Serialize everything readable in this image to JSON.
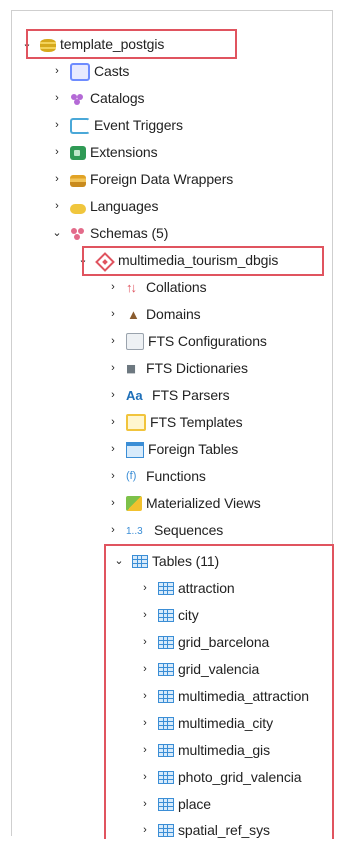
{
  "tree": {
    "database": {
      "label": "template_postgis"
    },
    "db_children": [
      {
        "label": "Casts",
        "icon": "casts-icon"
      },
      {
        "label": "Catalogs",
        "icon": "catalogs-icon"
      },
      {
        "label": "Event Triggers",
        "icon": "event-triggers-icon"
      },
      {
        "label": "Extensions",
        "icon": "extensions-icon"
      },
      {
        "label": "Foreign Data Wrappers",
        "icon": "foreign-data-wrappers-icon"
      },
      {
        "label": "Languages",
        "icon": "languages-icon"
      }
    ],
    "schemas": {
      "label": "Schemas (5)"
    },
    "schema": {
      "label": "multimedia_tourism_dbgis"
    },
    "schema_children": [
      {
        "label": "Collations",
        "icon": "collations-icon"
      },
      {
        "label": "Domains",
        "icon": "domains-icon"
      },
      {
        "label": "FTS Configurations",
        "icon": "fts-configurations-icon"
      },
      {
        "label": "FTS Dictionaries",
        "icon": "fts-dictionaries-icon"
      },
      {
        "label": "FTS Parsers",
        "icon": "fts-parsers-icon"
      },
      {
        "label": "FTS Templates",
        "icon": "fts-templates-icon"
      },
      {
        "label": "Foreign Tables",
        "icon": "foreign-tables-icon"
      },
      {
        "label": "Functions",
        "icon": "functions-icon"
      },
      {
        "label": "Materialized Views",
        "icon": "materialized-views-icon"
      },
      {
        "label": "Sequences",
        "icon": "sequences-icon"
      }
    ],
    "tables": {
      "label": "Tables (11)"
    },
    "table_items": [
      {
        "label": "attraction"
      },
      {
        "label": "city"
      },
      {
        "label": "grid_barcelona"
      },
      {
        "label": "grid_valencia"
      },
      {
        "label": "multimedia_attraction"
      },
      {
        "label": "multimedia_city"
      },
      {
        "label": "multimedia_gis"
      },
      {
        "label": "photo_grid_valencia"
      },
      {
        "label": "place"
      },
      {
        "label": "spatial_ref_sys"
      }
    ],
    "chevron_expanded": "⌄",
    "chevron_collapsed": "›",
    "highlight_color": "#e0545f"
  }
}
